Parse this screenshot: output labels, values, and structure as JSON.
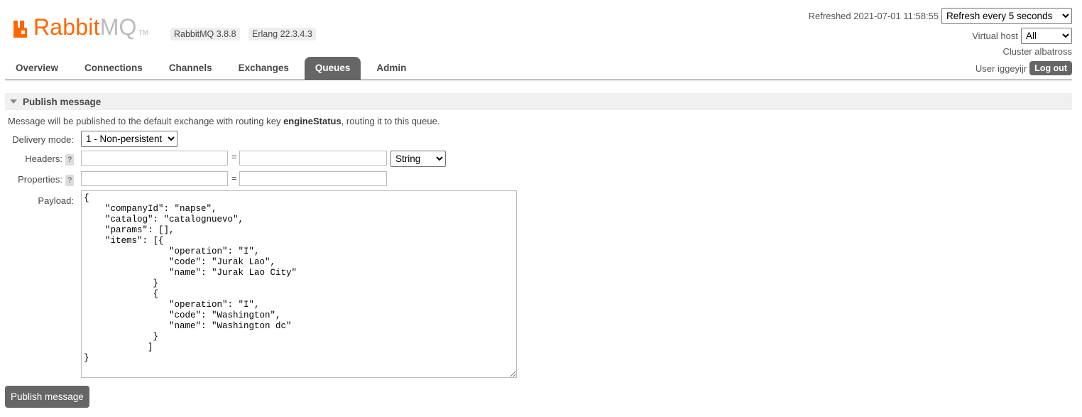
{
  "header": {
    "logo_rabbit": "Rabbit",
    "logo_mq": "MQ",
    "logo_tm": "TM",
    "version": "RabbitMQ 3.8.8",
    "erlang": "Erlang 22.3.4.3",
    "refreshed_label": "Refreshed 2021-07-01 11:58:55",
    "refresh_option": "Refresh every 5 seconds",
    "vhost_label": "Virtual host",
    "vhost_value": "All",
    "cluster_label": "Cluster albatross",
    "user_label": "User iggeyijr",
    "logout_label": "Log out",
    "brand_color": "#ff6600"
  },
  "tabs": [
    {
      "label": "Overview",
      "active": false
    },
    {
      "label": "Connections",
      "active": false
    },
    {
      "label": "Channels",
      "active": false
    },
    {
      "label": "Exchanges",
      "active": false
    },
    {
      "label": "Queues",
      "active": true
    },
    {
      "label": "Admin",
      "active": false
    }
  ],
  "publish": {
    "section_title": "Publish message",
    "intro_prefix": "Message will be published to the default exchange with routing key ",
    "routing_key": "engineStatus",
    "intro_suffix": ", routing it to this queue.",
    "delivery_mode_label": "Delivery mode:",
    "delivery_mode_value": "1 - Non-persistent",
    "headers_label": "Headers:",
    "headers_type": "String",
    "properties_label": "Properties:",
    "help_glyph": "?",
    "equals": "=",
    "payload_label": "Payload:",
    "payload": "{\n    \"companyId\": \"napse\",\n    \"catalog\": \"catalognuevo\",\n    \"params\": [],\n    \"items\": [{\n                \"operation\": \"I\",\n                \"code\": \"Jurak Lao\",\n                \"name\": \"Jurak Lao City\"\n             }\n             {\n                \"operation\": \"I\",\n                \"code\": \"Washington\",\n                \"name\": \"Washington dc\"\n             }\n            ]\n}",
    "button_label": "Publish message"
  }
}
